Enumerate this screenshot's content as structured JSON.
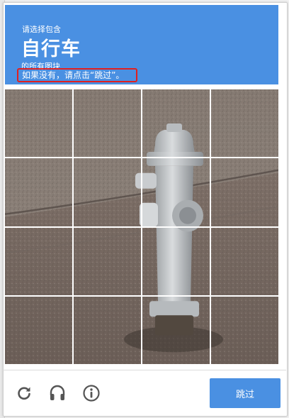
{
  "challenge": {
    "instruction_line1": "请选择包含",
    "target_object": "自行车",
    "instruction_line3": "的所有图块",
    "skip_hint": "如果没有，请点击“跳过”。"
  },
  "grid": {
    "rows": 4,
    "columns": 4,
    "tiles": [
      "tile-1",
      "tile-2",
      "tile-3",
      "tile-4",
      "tile-5",
      "tile-6",
      "tile-7",
      "tile-8",
      "tile-9",
      "tile-10",
      "tile-11",
      "tile-12",
      "tile-13",
      "tile-14",
      "tile-15",
      "tile-16"
    ]
  },
  "footer": {
    "icons": [
      "reload-icon",
      "audio-headphones-icon",
      "info-icon"
    ],
    "skip_button_label": "跳过"
  },
  "colors": {
    "header_bg": "#4a90e2",
    "hint_border": "#e02020",
    "button_bg": "#4a90e2",
    "icon_color": "#555555"
  }
}
